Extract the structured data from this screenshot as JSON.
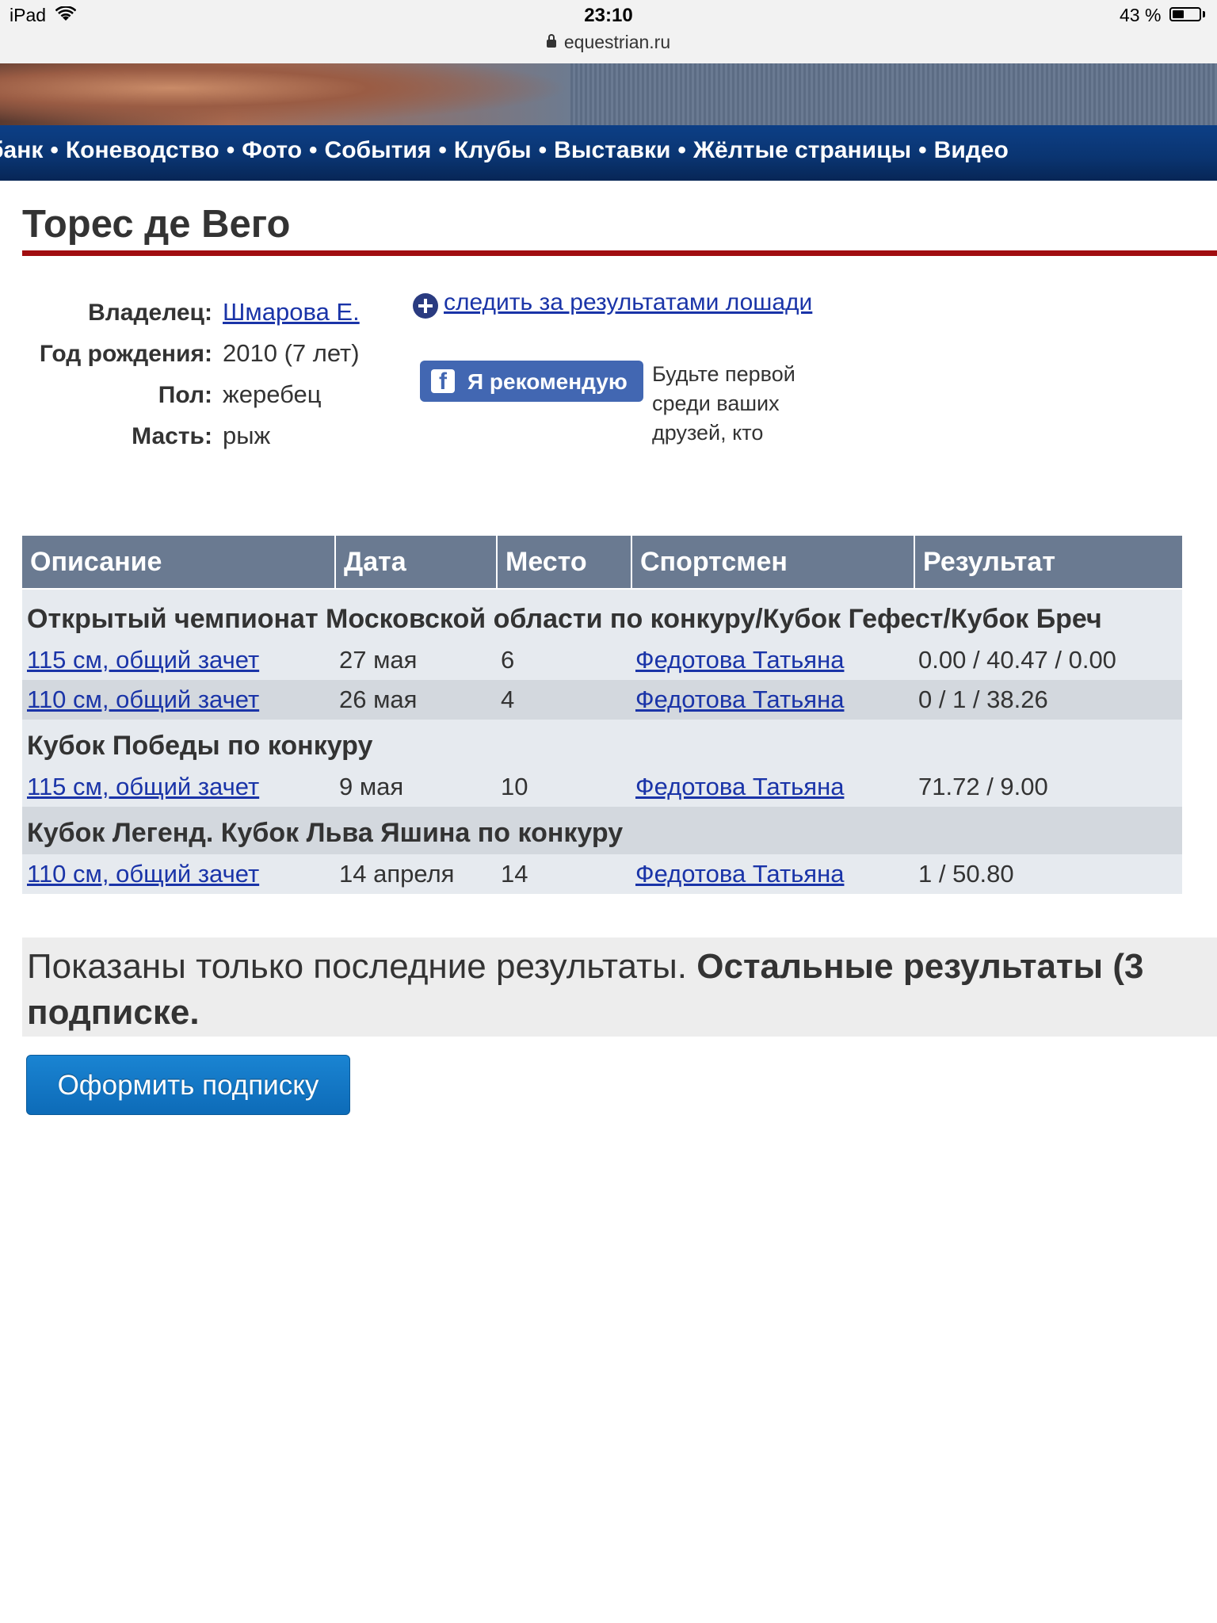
{
  "status_bar": {
    "device": "iPad",
    "time": "23:10",
    "battery": "43 %",
    "battery_level": 0.43,
    "url": "equestrian.ru"
  },
  "nav": {
    "items": [
      "банк",
      "Коневодство",
      "Фото",
      "События",
      "Клубы",
      "Выставки",
      "Жёлтые страницы",
      "Видео"
    ],
    "separator": "•"
  },
  "horse": {
    "name": "Торес де Вего",
    "owner_label": "Владелец:",
    "owner": "Шмарова Е.",
    "birth_label": "Год рождения:",
    "birth": "2010 (7 лет)",
    "sex_label": "Пол:",
    "sex": "жеребец",
    "color_label": "Масть:",
    "color": "рыж"
  },
  "follow_link": "следить за результатами лошади",
  "facebook": {
    "button_label": "Я рекомендую",
    "note": "Будьте первой среди ваших друзей, кто"
  },
  "table": {
    "headers": [
      "Описание",
      "Дата",
      "Место",
      "Спортсмен",
      "Результат"
    ],
    "groups": [
      {
        "title": "Открытый чемпионат Московской области по конкуру/Кубок Гефест/Кубок Бреч",
        "rows": [
          {
            "description": "115 см, общий зачет",
            "date": "27 мая",
            "place": "6",
            "rider": "Федотова Татьяна",
            "result": "0.00 / 40.47 / 0.00"
          },
          {
            "description": "110 см, общий зачет",
            "date": "26 мая",
            "place": "4",
            "rider": "Федотова Татьяна",
            "result": "0 / 1 / 38.26"
          }
        ]
      },
      {
        "title": "Кубок Победы по конкуру",
        "rows": [
          {
            "description": "115 см, общий зачет",
            "date": "9 мая",
            "place": "10",
            "rider": "Федотова Татьяна",
            "result": "71.72 / 9.00"
          }
        ]
      },
      {
        "title": "Кубок Легенд. Кубок Льва Яшина по конкуру",
        "rows": [
          {
            "description": "110 см, общий зачет",
            "date": "14 апреля",
            "place": "14",
            "rider": "Федотова Татьяна",
            "result": "1 / 50.80"
          }
        ]
      }
    ]
  },
  "notice": {
    "regular": "Показаны только последние результаты. ",
    "bold": "Остальные результаты (3 подписке."
  },
  "subscribe_button": "Оформить подписку",
  "colors": {
    "nav_bg": "#0a3470",
    "title_rule": "#a10d10",
    "table_header": "#6a7a91",
    "row_light": "#e6eaef",
    "row_dark": "#d3d8de",
    "link": "#1a34a8",
    "button": "#0d6bb8"
  }
}
